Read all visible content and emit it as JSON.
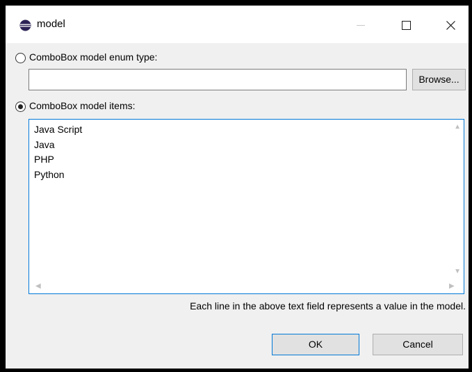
{
  "window": {
    "title": "model"
  },
  "enum_option": {
    "label": "ComboBox model enum type:",
    "checked": false
  },
  "enum_input": {
    "value": ""
  },
  "browse_button": {
    "label": "Browse..."
  },
  "items_option": {
    "label": "ComboBox model items:",
    "checked": true
  },
  "items_text": {
    "lines": [
      "Java Script",
      "Java",
      "PHP",
      "Python"
    ]
  },
  "hint_text": "Each line in the above text field represents a value in the model.",
  "ok_button": {
    "label": "OK"
  },
  "cancel_button": {
    "label": "Cancel"
  },
  "colors": {
    "accent": "#0078d7",
    "dialog_bg": "#f0f0f0",
    "button_bg": "#e1e1e1"
  }
}
